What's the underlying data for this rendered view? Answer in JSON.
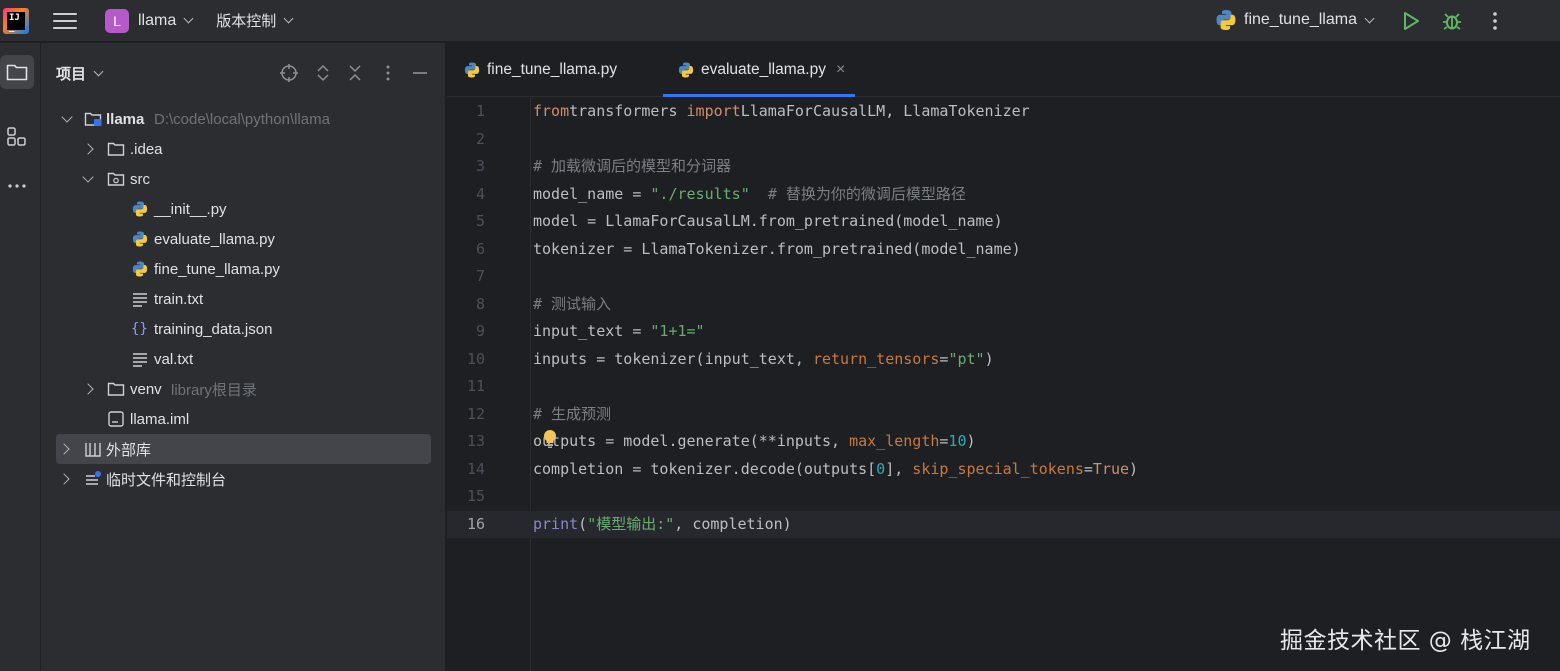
{
  "titlebar": {
    "project_letter": "L",
    "project_name": "llama",
    "vcs_label": "版本控制",
    "run_config": "fine_tune_llama"
  },
  "project_panel": {
    "title": "项目",
    "tree": [
      {
        "name": "llama",
        "hint": "D:\\code\\local\\python\\llama",
        "icon": "project-folder-icon",
        "expanded": true
      },
      {
        "name": ".idea",
        "icon": "folder-icon",
        "expanded": false
      },
      {
        "name": "src",
        "icon": "source-folder-icon",
        "expanded": true
      },
      {
        "name": "__init__.py",
        "icon": "python-file-icon"
      },
      {
        "name": "evaluate_llama.py",
        "icon": "python-file-icon"
      },
      {
        "name": "fine_tune_llama.py",
        "icon": "python-file-icon"
      },
      {
        "name": "train.txt",
        "icon": "text-file-icon"
      },
      {
        "name": "training_data.json",
        "icon": "json-file-icon"
      },
      {
        "name": "val.txt",
        "icon": "text-file-icon"
      },
      {
        "name": "venv",
        "hint": "library根目录",
        "icon": "folder-icon",
        "expanded": false
      },
      {
        "name": "llama.iml",
        "icon": "iml-file-icon"
      },
      {
        "name": "外部库",
        "icon": "library-icon",
        "expanded": false,
        "selected": true
      },
      {
        "name": "临时文件和控制台",
        "icon": "scratches-icon",
        "expanded": false
      }
    ]
  },
  "editor": {
    "tabs": [
      {
        "label": "fine_tune_llama.py",
        "active": false
      },
      {
        "label": "evaluate_llama.py",
        "active": true
      }
    ],
    "current_line": 16,
    "lines": [
      [
        [
          "kw",
          "from"
        ],
        [
          "",
          "transformers "
        ],
        [
          "kw",
          "import"
        ],
        [
          "",
          "LlamaForCausalLM, LlamaTokenizer"
        ]
      ],
      [],
      [
        [
          "cm",
          "# 加载微调后的模型和分词器"
        ]
      ],
      [
        [
          "",
          "model_name = "
        ],
        [
          "str",
          "\"./results\""
        ],
        [
          "",
          "  "
        ],
        [
          "cm",
          "# 替换为你的微调后模型路径"
        ]
      ],
      [
        [
          "",
          "model = LlamaForCausalLM.from_pretrained(model_name)"
        ]
      ],
      [
        [
          "",
          "tokenizer = LlamaTokenizer.from_pretrained(model_name)"
        ]
      ],
      [],
      [
        [
          "cm",
          "# 测试输入"
        ]
      ],
      [
        [
          "",
          "input_text = "
        ],
        [
          "str",
          "\"1+1=\""
        ]
      ],
      [
        [
          "",
          "inputs = tokenizer(input_text, "
        ],
        [
          "param",
          "return_tensors"
        ],
        [
          "",
          "="
        ],
        [
          "str",
          "\"pt\""
        ],
        [
          "",
          ")"
        ]
      ],
      [],
      [
        [
          "cm",
          "# 生成预测"
        ]
      ],
      [
        [
          "",
          "outputs = model.generate(**inputs, "
        ],
        [
          "param",
          "max_length"
        ],
        [
          "",
          "="
        ],
        [
          "num",
          "10"
        ],
        [
          "",
          ")"
        ]
      ],
      [
        [
          "",
          "completion = tokenizer.decode(outputs["
        ],
        [
          "num",
          "0"
        ],
        [
          "",
          "], "
        ],
        [
          "param",
          "skip_special_tokens"
        ],
        [
          "",
          "="
        ],
        [
          "kw",
          "True"
        ],
        [
          "",
          ")"
        ]
      ],
      [],
      [
        [
          "bi",
          "print"
        ],
        [
          "",
          "("
        ],
        [
          "str",
          "\"模型输出:\""
        ],
        [
          "",
          ", completion)"
        ]
      ]
    ]
  },
  "watermark": "掘金技术社区 @ 栈江湖"
}
